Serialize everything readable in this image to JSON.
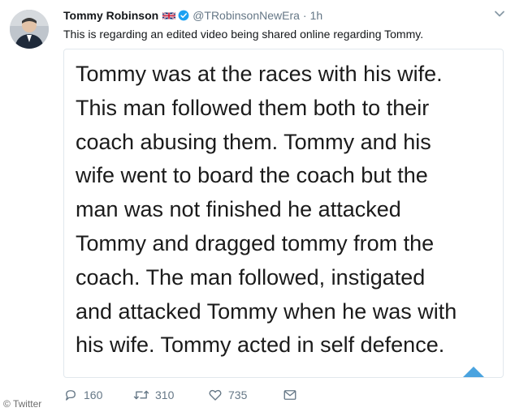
{
  "tweet": {
    "author_name": "Tommy Robinson",
    "handle": "@TRobinsonNewEra",
    "separator": "·",
    "time": "1h",
    "text": "This is regarding an edited video being shared online regarding Tommy.",
    "flag_icon": "uk-flag-icon",
    "verified_icon": "verified-badge-icon",
    "accent_color": "#1da1f2"
  },
  "media": {
    "lines": [
      "Tommy was at the races with his wife.",
      "This man followed them both to their",
      "coach abusing them.  Tommy and his",
      "wife went to board the coach but the",
      "man was not finished he attacked",
      "Tommy and dragged tommy from the",
      "coach.  The man followed, instigated",
      "and attacked Tommy when he was with",
      "his wife.  Tommy acted in self defence."
    ]
  },
  "actions": {
    "reply_count": "160",
    "retweet_count": "310",
    "like_count": "735"
  },
  "watermark": "© Twitter"
}
